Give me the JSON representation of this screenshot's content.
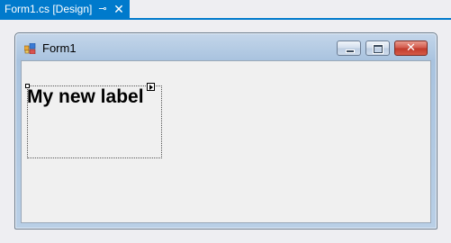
{
  "tab": {
    "title": "Form1.cs [Design]",
    "pin_glyph": "⊸",
    "close_glyph": "✕"
  },
  "form": {
    "title": "Form1",
    "buttons": {
      "close_glyph": "✕"
    }
  },
  "label": {
    "text": "My new label"
  },
  "icons": {
    "tab_pin": "pin-icon",
    "tab_close": "close-icon",
    "form_app": "form-app-icon",
    "minimize": "minimize-icon",
    "maximize": "maximize-icon",
    "close": "close-icon",
    "smart_tag": "smart-tag-arrow-icon"
  },
  "colors": {
    "tab_accent": "#007acc",
    "designer_bg": "#eeeef2",
    "client_bg": "#f0f0f0",
    "close_button": "#c0392b"
  }
}
